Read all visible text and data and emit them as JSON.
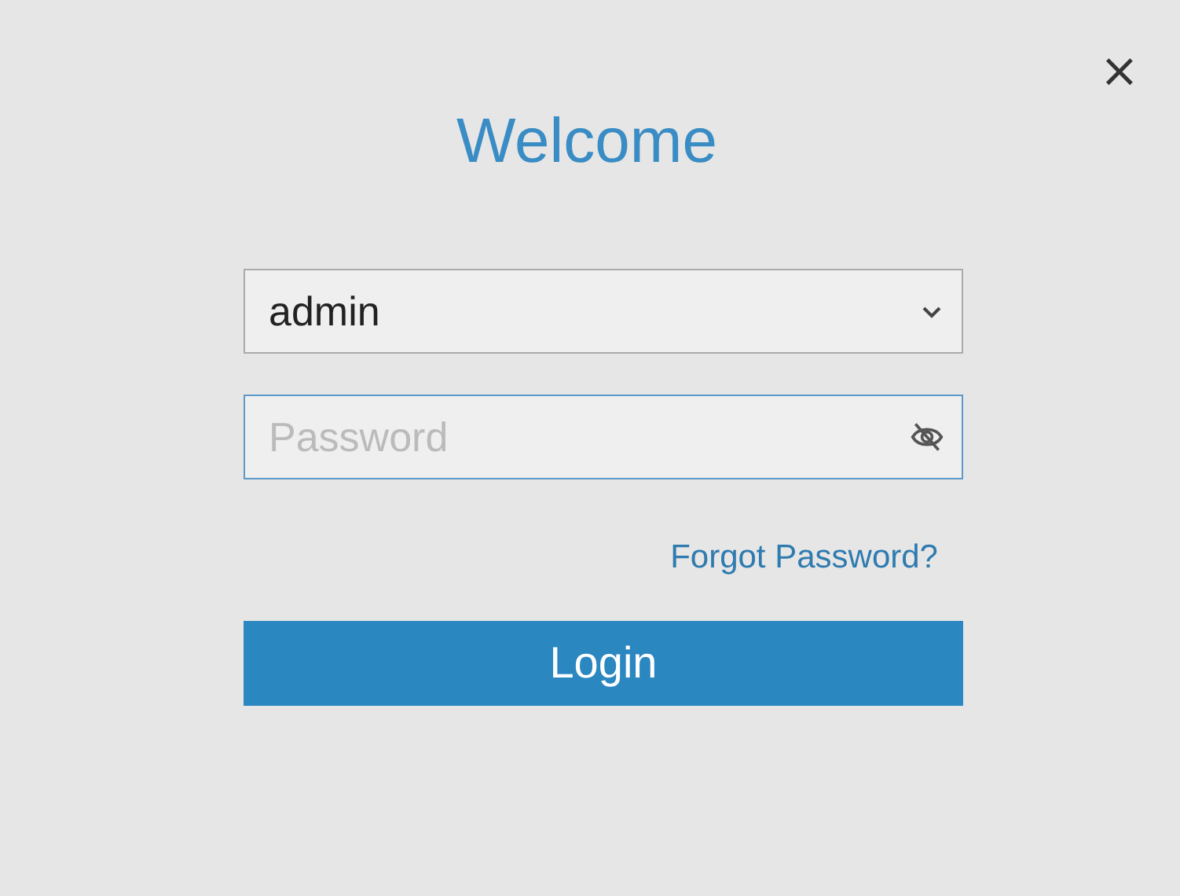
{
  "dialog": {
    "close": "×",
    "title": "Welcome"
  },
  "username": {
    "value": "admin"
  },
  "password": {
    "placeholder": "Password",
    "visible": false
  },
  "forgot_link": "Forgot Password?",
  "buttons": [
    "Login"
  ]
}
